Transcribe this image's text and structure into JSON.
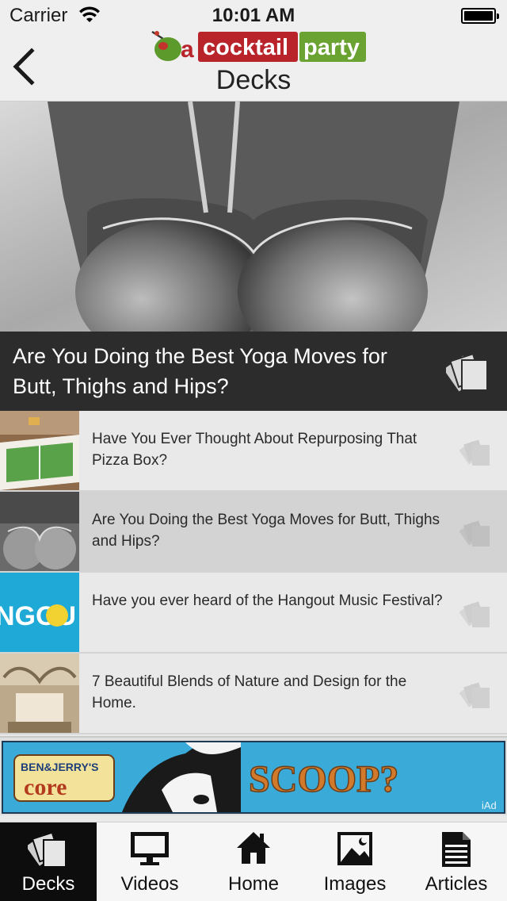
{
  "status_bar": {
    "carrier": "Carrier",
    "time": "10:01 AM"
  },
  "nav": {
    "title": "Decks",
    "logo": {
      "a": "a",
      "cocktail": "cocktail",
      "party": "party"
    }
  },
  "hero": {
    "title": "Are You Doing the Best Yoga Moves for Butt, Thighs and Hips?"
  },
  "list": [
    {
      "title": "Have You Ever Thought About Repurposing That Pizza Box?",
      "selected": false
    },
    {
      "title": "Are You Doing the Best Yoga Moves for Butt, Thighs and Hips?",
      "selected": true
    },
    {
      "title": "Have you ever heard of the Hangout Music Festival?",
      "selected": false
    },
    {
      "title": "7 Beautiful Blends of Nature and Design for the Home.",
      "selected": false
    }
  ],
  "banner": {
    "brand_top": "BEN&JERRY'S",
    "brand": "core",
    "headline": "SCOOP?",
    "tag": "iAd"
  },
  "tabs": [
    {
      "label": "Decks",
      "icon": "decks-icon",
      "active": true
    },
    {
      "label": "Videos",
      "icon": "monitor-icon",
      "active": false
    },
    {
      "label": "Home",
      "icon": "house-icon",
      "active": false
    },
    {
      "label": "Images",
      "icon": "image-icon",
      "active": false
    },
    {
      "label": "Articles",
      "icon": "document-icon",
      "active": false
    }
  ],
  "colors": {
    "caption_bg": "#2c2c2c",
    "logo_red": "#b8242a",
    "logo_green": "#6aa332",
    "active_tab": "#0d0d0d",
    "ad_blue": "#3aaad8"
  }
}
